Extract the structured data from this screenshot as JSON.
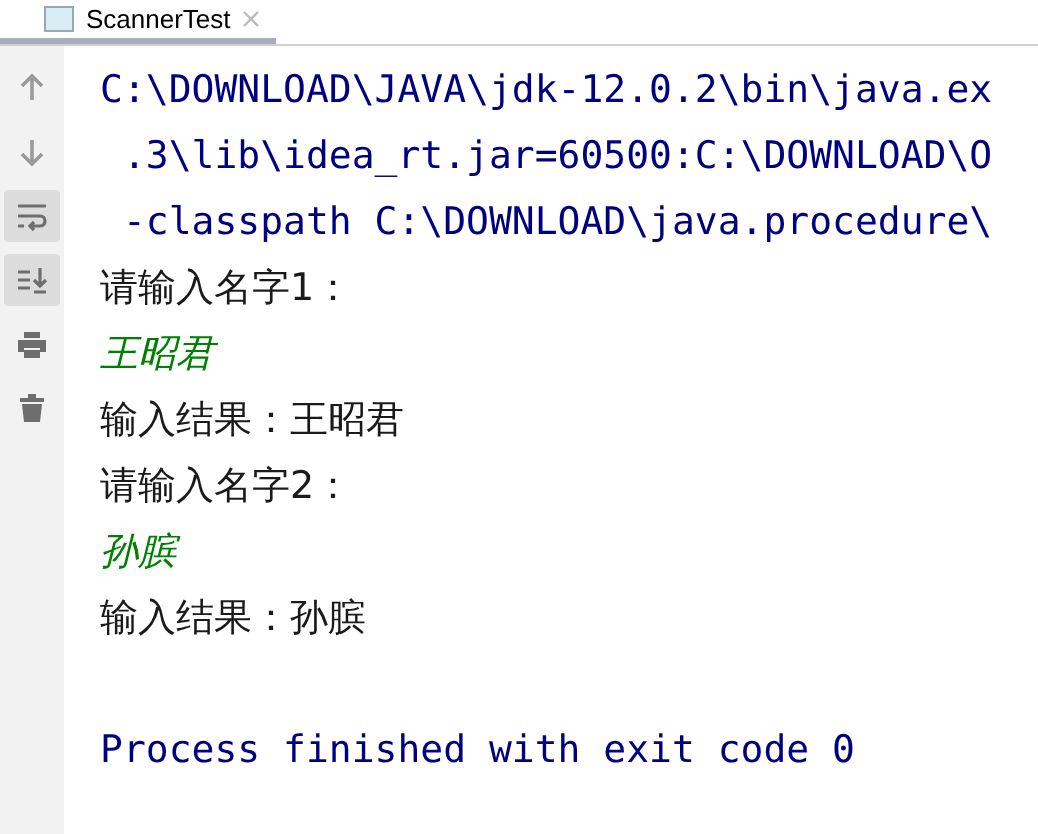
{
  "tab": {
    "title": "ScannerTest",
    "selected": true
  },
  "toolbar": [
    {
      "kind": "up",
      "on": false
    },
    {
      "kind": "down",
      "on": false
    },
    {
      "kind": "wrap",
      "on": true
    },
    {
      "kind": "scroll-end",
      "on": true
    },
    {
      "kind": "print",
      "on": false
    },
    {
      "kind": "trash",
      "on": false
    }
  ],
  "console_lines": [
    {
      "kind": "system",
      "text": "C:\\DOWNLOAD\\JAVA\\jdk-12.0.2\\bin\\java.ex"
    },
    {
      "kind": "system",
      "text": " .3\\lib\\idea_rt.jar=60500:C:\\DOWNLOAD\\O"
    },
    {
      "kind": "system",
      "text": " -classpath C:\\DOWNLOAD\\java.procedure\\"
    },
    {
      "kind": "output",
      "text": "请输入名字1："
    },
    {
      "kind": "input",
      "text": "王昭君"
    },
    {
      "kind": "output",
      "text": "输入结果：王昭君"
    },
    {
      "kind": "output",
      "text": "请输入名字2："
    },
    {
      "kind": "input",
      "text": "孙膑"
    },
    {
      "kind": "output",
      "text": "输入结果：孙膑"
    },
    {
      "kind": "blank"
    },
    {
      "kind": "system",
      "text": "Process finished with exit code 0"
    }
  ]
}
